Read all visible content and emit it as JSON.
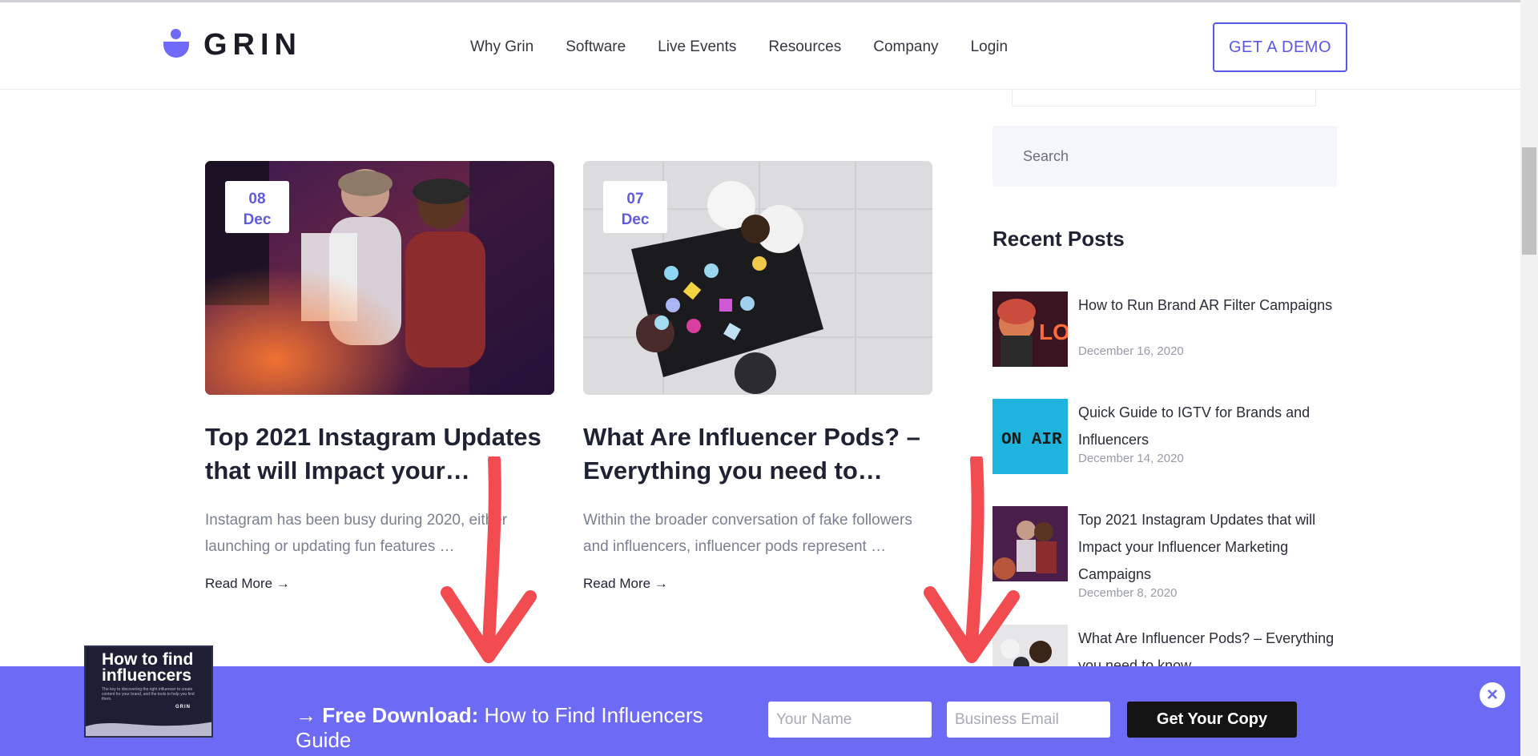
{
  "header": {
    "logo_text": "GRIN",
    "nav": [
      "Why Grin",
      "Software",
      "Live Events",
      "Resources",
      "Company",
      "Login"
    ],
    "demo_button": "GET A DEMO"
  },
  "posts": [
    {
      "day": "08",
      "month": "Dec",
      "title": "Top 2021 Instagram Updates that will Impact your…",
      "excerpt": "Instagram has been busy during 2020, either launching or updating fun features …",
      "read_more": "Read More →"
    },
    {
      "day": "07",
      "month": "Dec",
      "title": "What Are Influencer Pods? – Everything you need to…",
      "excerpt": "Within the broader conversation of fake followers and influencers, influencer pods represent …",
      "read_more": "Read More →"
    }
  ],
  "sidebar": {
    "search_placeholder": "Search",
    "recent_title": "Recent Posts",
    "recent_posts": [
      {
        "title": "How to Run Brand AR Filter Campaigns",
        "date": "December 16, 2020",
        "image_text": "LO"
      },
      {
        "title": "Quick Guide to IGTV for Brands and Influencers",
        "date": "December 14, 2020",
        "image_text": "ON AIR"
      },
      {
        "title": "Top 2021 Instagram Updates that will Impact your Influencer Marketing Campaigns",
        "date": "December 8, 2020"
      },
      {
        "title": "What Are Influencer Pods? – Everything you need to know"
      }
    ]
  },
  "download_bar": {
    "guide_title": "How to find influencers",
    "guide_subtitle": "The key to discovering the right influencer to create content for your brand, and the tools to help you find them.",
    "guide_logo": "GRIN",
    "arrow": "→",
    "label_bold": "Free Download:",
    "label_rest": "How to Find Influencers Guide",
    "name_placeholder": "Your Name",
    "email_placeholder": "Business Email",
    "submit": "Get Your Copy",
    "close_symbol": "×"
  },
  "colors": {
    "accent": "#5e5bdf",
    "bar": "#6d6af5",
    "arrow": "#f24b50"
  }
}
